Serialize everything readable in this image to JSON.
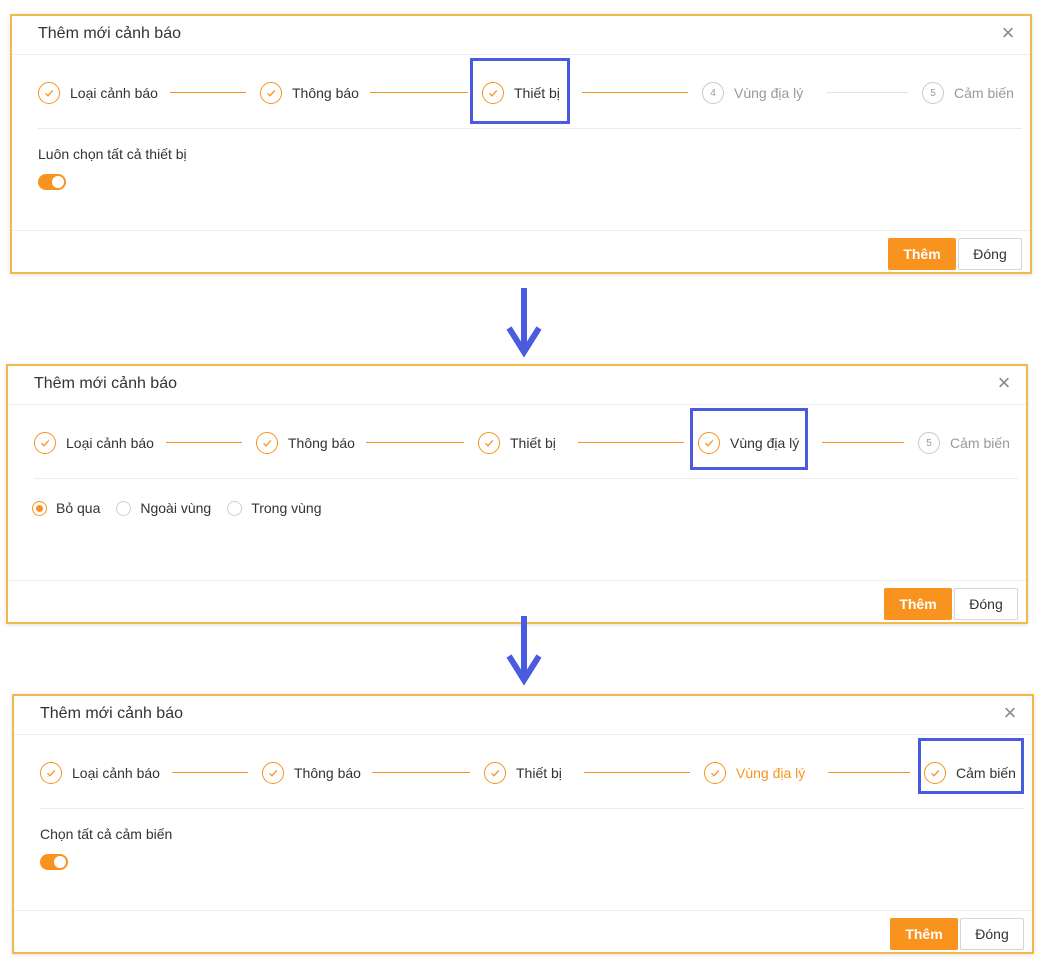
{
  "dialog_title": "Thêm mới cảnh báo",
  "close_symbol": "×",
  "buttons": {
    "add": "Thêm",
    "close": "Đóng"
  },
  "colors": {
    "accent": "#f7931e",
    "panel_border": "#f1b84b",
    "highlight": "#4a5be0",
    "arrow": "#4a5be0"
  },
  "icons": {
    "close": "close-icon",
    "check": "check-icon",
    "arrow": "arrow-down-icon"
  },
  "panels": [
    {
      "steps": [
        {
          "label": "Loại cảnh báo",
          "marker": "",
          "state": "done"
        },
        {
          "label": "Thông báo",
          "marker": "",
          "state": "done"
        },
        {
          "label": "Thiết bị",
          "marker": "",
          "state": "done"
        },
        {
          "label": "Vùng địa lý",
          "marker": "4",
          "state": "pending"
        },
        {
          "label": "Cảm biến",
          "marker": "5",
          "state": "pending"
        }
      ],
      "highlighted_step": 3,
      "field_label": "Luôn chọn tất cả thiết bị",
      "toggle_on": true
    },
    {
      "steps": [
        {
          "label": "Loại cảnh báo",
          "marker": "",
          "state": "done"
        },
        {
          "label": "Thông báo",
          "marker": "",
          "state": "done"
        },
        {
          "label": "Thiết bị",
          "marker": "",
          "state": "done"
        },
        {
          "label": "Vùng địa lý",
          "marker": "",
          "state": "done"
        },
        {
          "label": "Cảm biến",
          "marker": "5",
          "state": "pending"
        }
      ],
      "highlighted_step": 4,
      "radio_options": [
        {
          "label": "Bỏ qua",
          "checked": true
        },
        {
          "label": "Ngoài vùng",
          "checked": false
        },
        {
          "label": "Trong vùng",
          "checked": false
        }
      ]
    },
    {
      "steps": [
        {
          "label": "Loại cảnh báo",
          "marker": "",
          "state": "done"
        },
        {
          "label": "Thông báo",
          "marker": "",
          "state": "done"
        },
        {
          "label": "Thiết bị",
          "marker": "",
          "state": "done"
        },
        {
          "label": "Vùng địa lý",
          "marker": "",
          "state": "active"
        },
        {
          "label": "Cảm biến",
          "marker": "",
          "state": "done"
        }
      ],
      "highlighted_step": 5,
      "field_label": "Chọn tất cả cảm biến",
      "toggle_on": true
    }
  ]
}
